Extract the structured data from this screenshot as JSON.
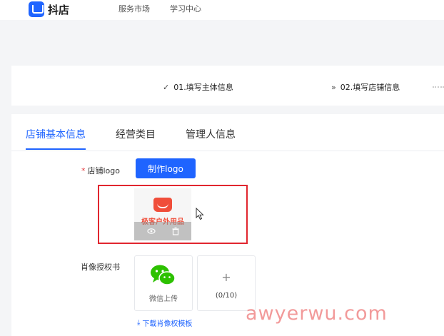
{
  "header": {
    "brand": "抖店",
    "nav": [
      "服务市场",
      "学习中心"
    ]
  },
  "steps": [
    {
      "icon": "check-icon",
      "label": "01.填写主体信息"
    },
    {
      "icon": "double-chevron-right-icon",
      "label": "02.填写店铺信息"
    }
  ],
  "tabs": [
    {
      "label": "店铺基本信息",
      "active": true
    },
    {
      "label": "经营类目",
      "active": false
    },
    {
      "label": "管理人信息",
      "active": false
    }
  ],
  "form": {
    "logo": {
      "required_mark": "*",
      "label": "店铺logo",
      "make_button": "制作logo",
      "preview_text": "极客户外用品"
    },
    "portrait": {
      "label": "肖像授权书",
      "wechat_upload": "微信上传",
      "add_symbol": "+",
      "count": "(0/10)",
      "download_link": "下载肖像权模板"
    }
  },
  "watermark": "awyerwu.com",
  "colors": {
    "accent": "#1f64ff",
    "highlight": "#e1262f",
    "required": "#e4393c",
    "wechat": "#2dc100"
  }
}
